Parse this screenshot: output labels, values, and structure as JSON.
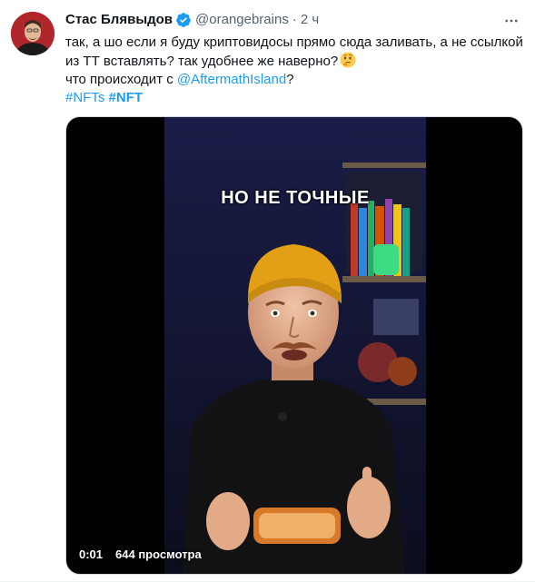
{
  "tweet": {
    "author_name": "Стас Блявыдов",
    "author_handle": "@orangebrains",
    "separator": "·",
    "time": "2 ч",
    "text_line1": "так, а шо если я буду криптовидосы прямо сюда заливать, а не ссылкой",
    "text_line2": "из ТТ вставлять? так удобнее же наверно?",
    "text_line3_prefix": "что происходит с ",
    "mention": "@AftermathIsland",
    "text_line3_suffix": "?",
    "hashtag1": "#NFTs",
    "hashtag2": "#NFT",
    "emoji": "thinking-face-icon"
  },
  "video": {
    "caption": "НО НЕ ТОЧНЫЕ",
    "elapsed": "0:01",
    "views": "644 просмотра"
  },
  "colors": {
    "accent": "#1d9bf0",
    "text_primary": "#0f1419",
    "text_secondary": "#536471",
    "beanie": "#e3a017"
  }
}
